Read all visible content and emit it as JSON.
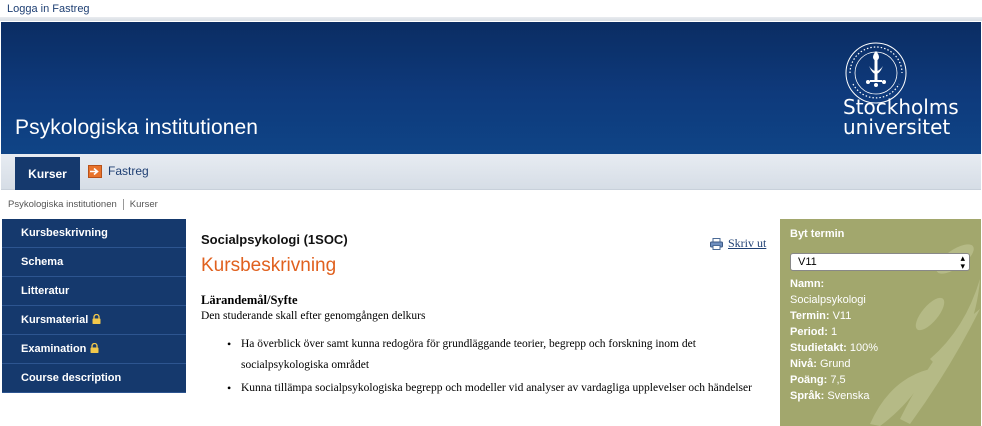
{
  "topbar": {
    "login_link": "Logga in Fastreg"
  },
  "banner": {
    "department": "Psykologiska institutionen",
    "university_line1": "Stockholms",
    "university_line2": "universitet"
  },
  "tabs": {
    "active": "Kurser",
    "fastreg": "Fastreg"
  },
  "breadcrumb": [
    "Psykologiska institutionen",
    "Kurser"
  ],
  "sidebar": {
    "items": [
      {
        "label": "Kursbeskrivning",
        "locked": false
      },
      {
        "label": "Schema",
        "locked": false
      },
      {
        "label": "Litteratur",
        "locked": false
      },
      {
        "label": "Kursmaterial",
        "locked": true
      },
      {
        "label": "Examination",
        "locked": true
      },
      {
        "label": "Course description",
        "locked": false
      }
    ]
  },
  "main": {
    "course_title": "Socialpsykologi (1SOC)",
    "heading": "Kursbeskrivning",
    "print_label": "Skriv ut",
    "section_heading": "Lärandemål/Syfte",
    "intro": "Den studerande skall efter genomgången delkurs",
    "goals": [
      "Ha överblick över samt kunna redogöra för grundläggande teorier, begrepp och forskning inom det socialpsykologiska området",
      "Kunna tillämpa socialpsykologiska begrepp och modeller vid analyser av vardagliga upplevelser och händelser"
    ]
  },
  "term_box": {
    "heading": "Byt termin",
    "selected_term": "V11",
    "name_label": "Namn:",
    "name_value": "Socialpsykologi",
    "term_label": "Termin:",
    "term_value": "V11",
    "period_label": "Period:",
    "period_value": "1",
    "pace_label": "Studietakt:",
    "pace_value": "100%",
    "level_label": "Nivå:",
    "level_value": "Grund",
    "credits_label": "Poäng:",
    "credits_value": "7,5",
    "language_label": "Språk:",
    "language_value": "Svenska"
  },
  "colors": {
    "banner": "#0e3a7c",
    "nav": "#15396d",
    "accent_orange": "#e0611f",
    "term_box": "#a2a76d"
  },
  "icons": [
    "su-seal-icon",
    "arrow-right-icon",
    "printer-icon",
    "lock-icon",
    "select-arrows-icon"
  ]
}
